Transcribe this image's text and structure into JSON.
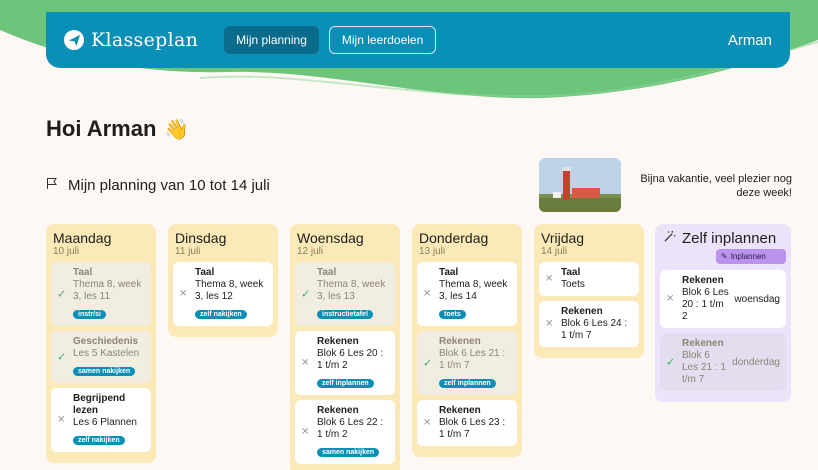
{
  "nav": {
    "brand": "Klasseplan",
    "tabs": [
      "Mijn planning",
      "Mijn leerdoelen"
    ],
    "user": "Arman"
  },
  "greeting": {
    "text": "Hoi Arman",
    "emoji": "👋"
  },
  "week_title": "Mijn planning van 10 tot 14 juli",
  "holiday_message": "Bijna vakantie, veel plezier nog deze week!",
  "days": [
    {
      "name": "Maandag",
      "date": "10 juli",
      "cards": [
        {
          "subject": "Taal",
          "desc": "Thema 8, week 3, les 11",
          "tag": "instr/si",
          "done": true
        },
        {
          "subject": "Geschiedenis",
          "desc": "Les 5 Kastelen",
          "tag": "samen nakijken",
          "done": true
        },
        {
          "subject": "Begrijpend lezen",
          "desc": "Les 6 Plannen",
          "tag": "zelf nakijken",
          "done": false
        }
      ]
    },
    {
      "name": "Dinsdag",
      "date": "11 juli",
      "cards": [
        {
          "subject": "Taal",
          "desc": "Thema 8, week 3, les 12",
          "tag": "zelf nakijken",
          "done": false
        }
      ]
    },
    {
      "name": "Woensdag",
      "date": "12 juli",
      "cards": [
        {
          "subject": "Taal",
          "desc": "Thema 8, week 3, les 13",
          "tag": "instructietafel",
          "done": true
        },
        {
          "subject": "Rekenen",
          "desc": "Blok 6 Les 20 : 1 t/m 2",
          "tag": "zelf inplannen",
          "done": false
        },
        {
          "subject": "Rekenen",
          "desc": "Blok 6 Les 22 : 1 t/m 2",
          "tag": "samen nakijken",
          "done": false
        }
      ]
    },
    {
      "name": "Donderdag",
      "date": "13 juli",
      "cards": [
        {
          "subject": "Taal",
          "desc": "Thema 8, week 3, les 14",
          "tag": "toets",
          "done": false
        },
        {
          "subject": "Rekenen",
          "desc": "Blok 6 Les 21 : 1 t/m 7",
          "tag": "zelf inplannen",
          "done": true
        },
        {
          "subject": "Rekenen",
          "desc": "Blok 6 Les 23 : 1 t/m 7",
          "tag": "",
          "done": false
        }
      ]
    },
    {
      "name": "Vrijdag",
      "date": "14 juli",
      "cards": [
        {
          "subject": "Taal",
          "desc": "Toets",
          "tag": "",
          "done": false
        },
        {
          "subject": "Rekenen",
          "desc": "Blok 6 Les 24 : 1 t/m 7",
          "tag": "",
          "done": false
        }
      ]
    }
  ],
  "self_plan": {
    "title": "Zelf inplannen",
    "button": "Inplannen",
    "items": [
      {
        "subject": "Rekenen",
        "desc": "Blok 6 Les 20 : 1 t/m 2",
        "day": "woensdag",
        "done": false
      },
      {
        "subject": "Rekenen",
        "desc": "Blok 6 Les 21 : 1 t/m 7",
        "day": "donderdag",
        "done": true
      }
    ]
  },
  "colors": {
    "brand": "#0a8fb6",
    "wave": "#6cc57a",
    "day_bg": "#fce9b8",
    "self_bg": "#ece3fb",
    "tag": "#0a8fb6"
  }
}
